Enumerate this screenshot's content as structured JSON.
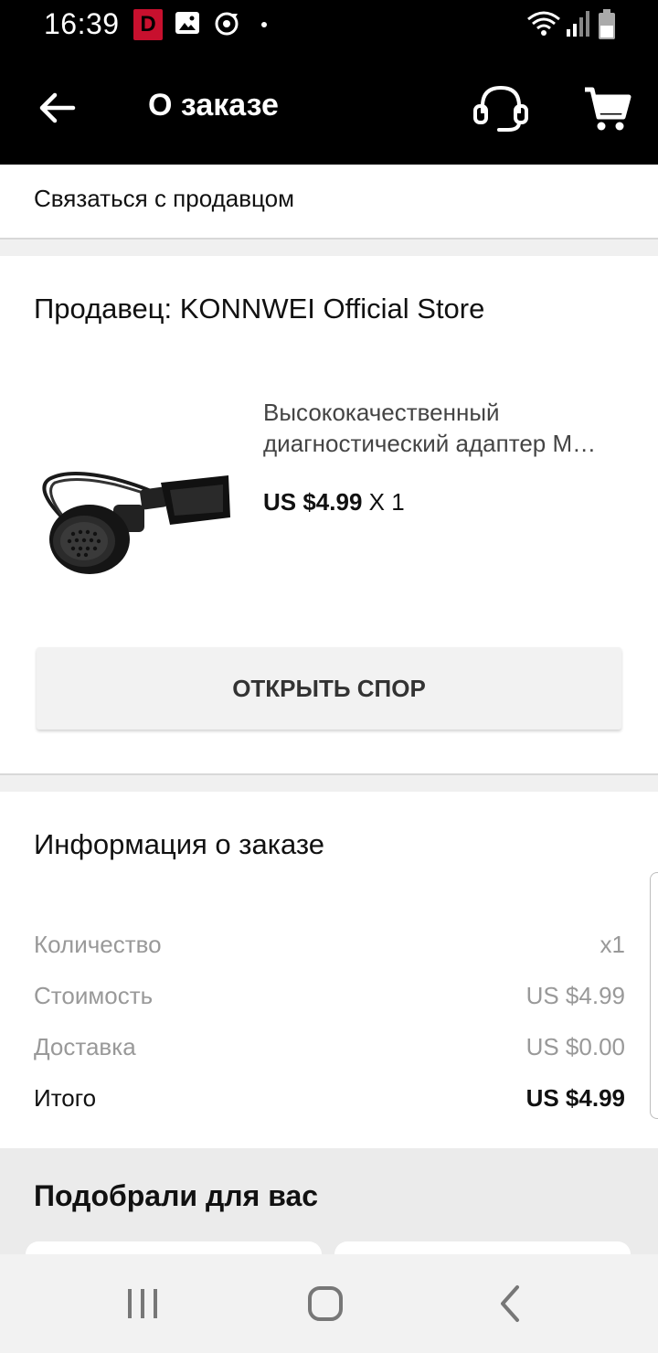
{
  "status_bar": {
    "time": "16:39",
    "notification_badge": "D",
    "icons": [
      "gallery-icon",
      "sync-icon",
      "wifi-icon",
      "signal-icon",
      "battery-icon"
    ]
  },
  "app_bar": {
    "title": "О заказе",
    "icons": [
      "back-arrow-icon",
      "headset-icon",
      "cart-icon"
    ]
  },
  "contact": {
    "label": "Связаться с продавцом"
  },
  "seller": {
    "name": "Продавец: KONNWEI Official Store"
  },
  "product": {
    "title_line1": "Высококачественный",
    "title_line2": "диагностический адаптер M…",
    "price": "US $4.99",
    "quantity": "X 1"
  },
  "dispute": {
    "label": "ОТКРЫТЬ СПОР"
  },
  "order_info": {
    "title": "Информация о заказе",
    "rows": [
      {
        "label": "Количество",
        "value": "x1"
      },
      {
        "label": "Стоимость",
        "value": "US $4.99"
      },
      {
        "label": "Доставка",
        "value": "US $0.00"
      },
      {
        "label": "Итого",
        "value": "US $4.99"
      }
    ]
  },
  "recommend": {
    "title": "Подобрали для вас"
  },
  "colors": {
    "app_bar_bg": "#000000",
    "badge_red": "#c8102e",
    "muted_text": "#999999",
    "button_bg": "#f2f2f2"
  }
}
